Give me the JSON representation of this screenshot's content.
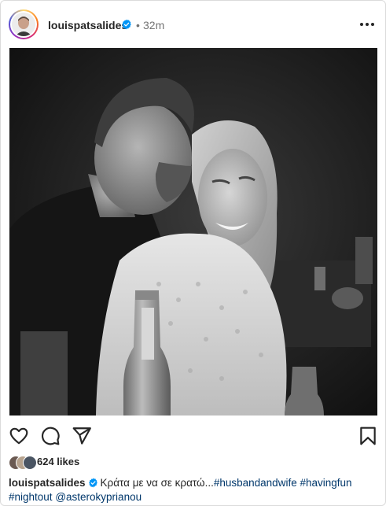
{
  "post": {
    "username": "louispatsalides",
    "time_separator": "•",
    "time": "32m",
    "likes": "624 likes",
    "caption": {
      "username": "louispatsalides",
      "text": "Κράτα με να σε κρατώ...",
      "tags": [
        "#husbandandwife",
        "#havingfun",
        "#nightout",
        "@asterokyprianou"
      ]
    }
  },
  "colors": {
    "verified": "#0095f6",
    "tag": "#00376b",
    "muted": "#737373",
    "text": "#262626"
  },
  "icons": {
    "more": "more-horizontal-icon",
    "like": "heart-outline-icon",
    "comment": "comment-icon",
    "share": "paper-plane-icon",
    "save": "bookmark-icon",
    "verified": "verified-badge-icon"
  }
}
